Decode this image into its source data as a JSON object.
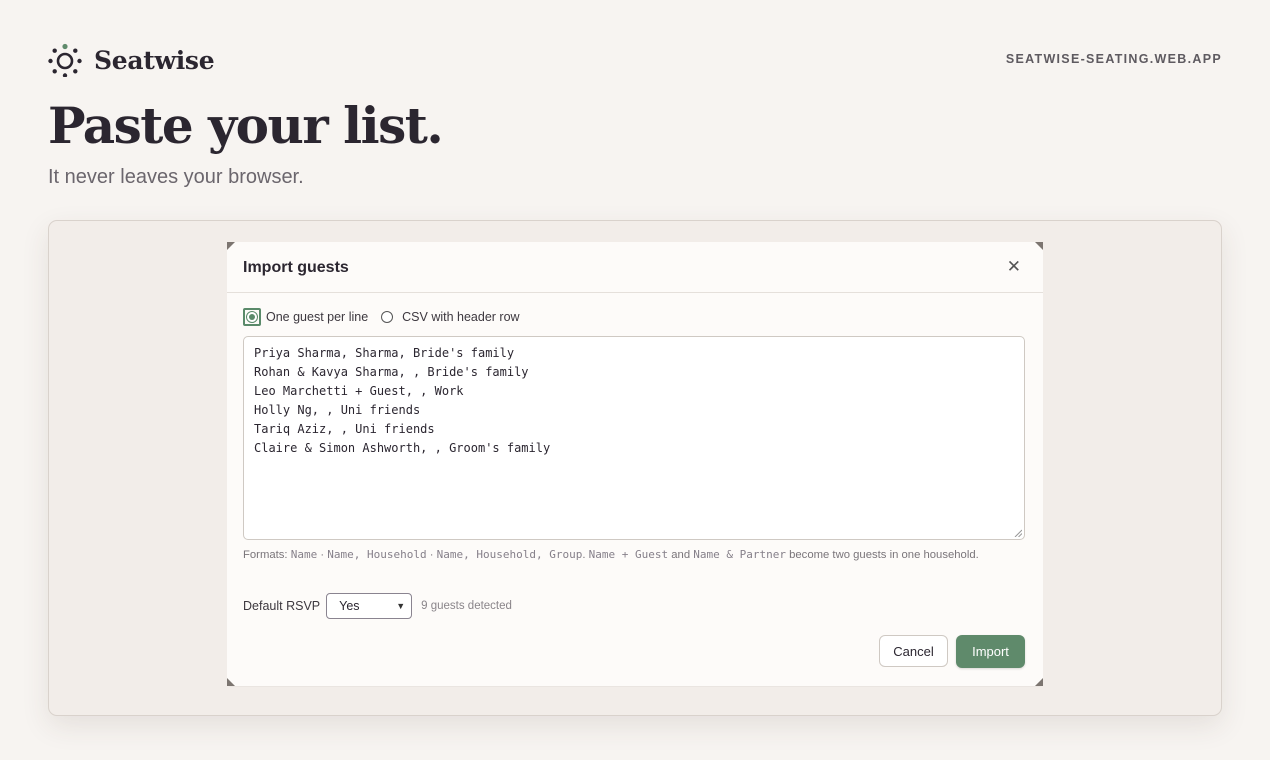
{
  "brand": {
    "name": "Seatwise",
    "icon": "sun-icon",
    "accent": "#5f8a6b"
  },
  "site_url": "SEATWISE-SEATING.WEB.APP",
  "hero": {
    "title": "Paste your list.",
    "subtitle": "It never leaves your browser."
  },
  "dialog": {
    "title": "Import guests",
    "close_icon": "close-icon",
    "format_options": [
      {
        "label": "One guest per line",
        "selected": true
      },
      {
        "label": "CSV with header row",
        "selected": false
      }
    ],
    "guest_list": [
      "Priya Sharma, Sharma, Bride's family",
      "Rohan & Kavya Sharma, , Bride's family",
      "Leo Marchetti + Guest, , Work",
      "Holly Ng, , Uni friends",
      "Tariq Aziz, , Uni friends",
      "Claire & Simon Ashworth, , Groom's family"
    ],
    "hint": {
      "prefix": "Formats: ",
      "code1": "Name",
      "sep1": " · ",
      "code2": "Name, Household",
      "sep2": " · ",
      "code3": "Name, Household, Group",
      "mid": ". ",
      "code4": "Name + Guest",
      "and": " and ",
      "code5": "Name & Partner",
      "suffix": " become two guests in one household."
    },
    "rsvp": {
      "label": "Default RSVP",
      "value": "Yes"
    },
    "detected": "9 guests detected",
    "cancel_label": "Cancel",
    "import_label": "Import"
  }
}
